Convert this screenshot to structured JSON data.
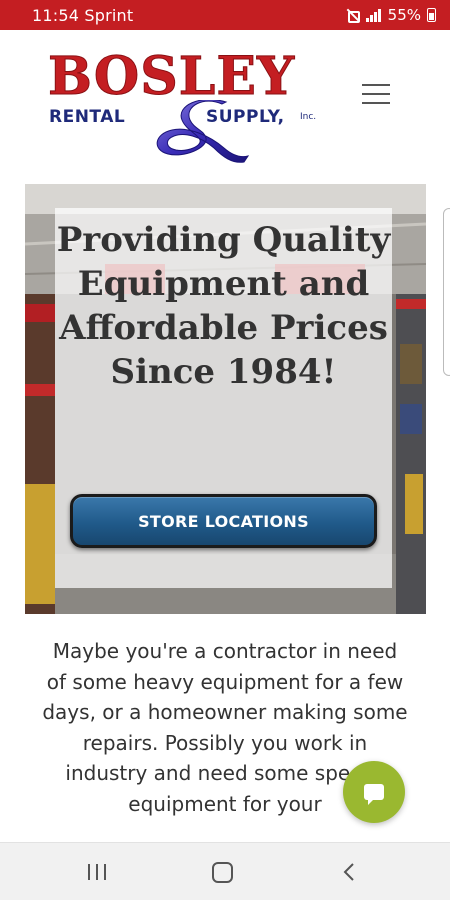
{
  "status_bar": {
    "time_carrier": "11:54 Sprint",
    "battery": "55%"
  },
  "logo": {
    "name": "BOSLEY",
    "rental": "RENTAL",
    "supply": "SUPPLY,",
    "inc": "Inc."
  },
  "hero": {
    "heading": "Providing Quality Equipment and Affordable Prices Since 1984!",
    "button_label": "STORE LOCATIONS"
  },
  "intro_text": "Maybe you're a contractor in need of some heavy equipment for a few days, or a homeowner making some repairs.   Possibly you work in industry and need some special equipment for your",
  "colors": {
    "status_bar": "#c41e22",
    "brand_red": "#c41e22",
    "brand_blue": "#1f2a7a",
    "button_blue": "#205a8a",
    "chat_green": "#9ab830"
  },
  "icons": {
    "menu": "hamburger-menu-icon",
    "chat": "chat-bubble-icon",
    "nav_recent": "recent-apps-icon",
    "nav_home": "home-icon",
    "nav_back": "back-icon"
  }
}
